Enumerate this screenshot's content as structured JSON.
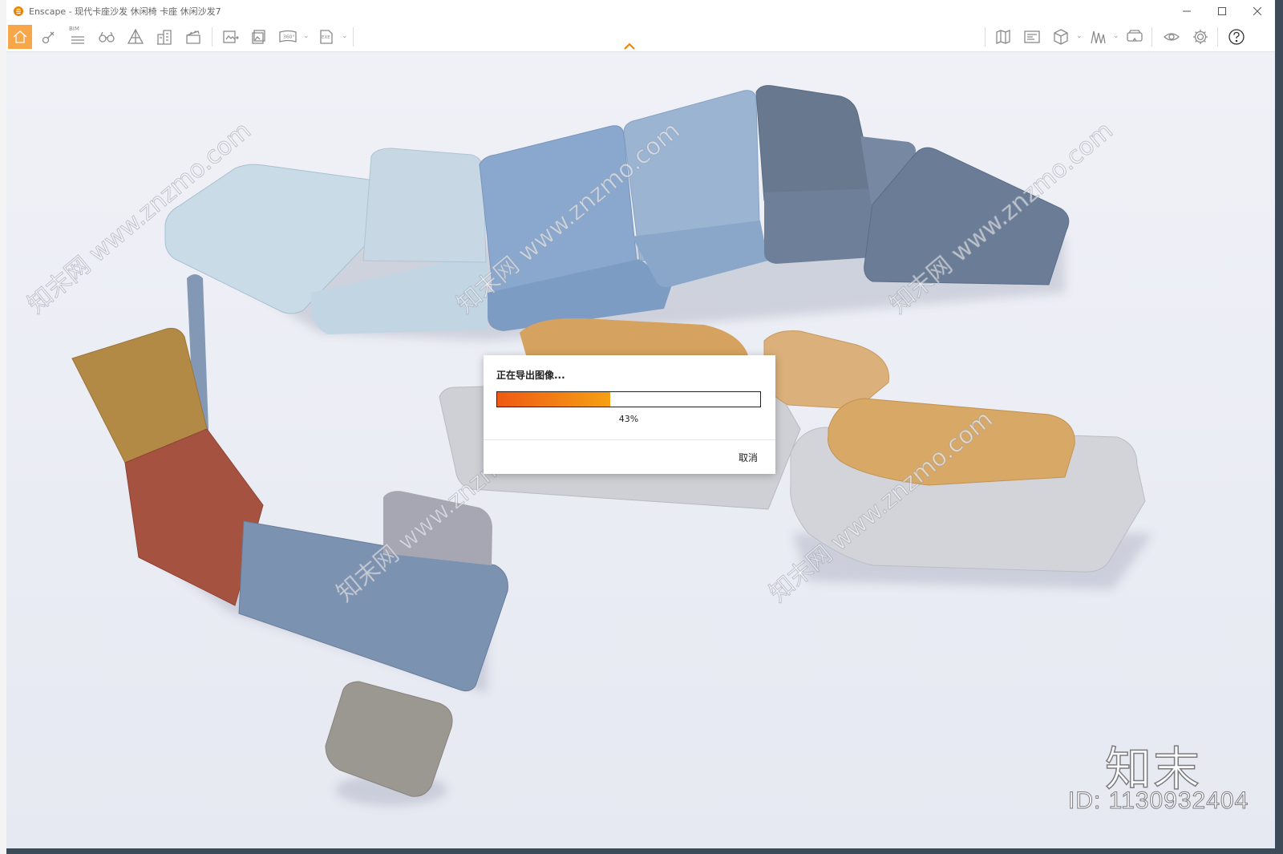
{
  "window": {
    "title": "Enscape - 现代卡座沙发 休闲椅 卡座 休闲沙发7"
  },
  "toolbar": {
    "bim_label": "BIM",
    "left_icons": [
      "home-icon",
      "paint-icon",
      "bim-list-icon",
      "binoculars-icon",
      "perspective-icon",
      "buildings-icon",
      "clapper-icon",
      "screenshot-icon",
      "batch-render-icon",
      "panorama-icon",
      "export-exe-icon"
    ],
    "right_icons": [
      "map-icon",
      "sketch-icon",
      "cube-icon",
      "visual-settings-icon",
      "vr-headset-icon",
      "eye-icon",
      "gear-icon",
      "help-icon"
    ],
    "panorama_label": "360°",
    "exe_label": "EXE"
  },
  "dialog": {
    "title": "正在导出图像...",
    "progress": 0.43,
    "progress_label": "43%",
    "cancel_label": "取消"
  },
  "watermark": {
    "logo": "知末",
    "id": "ID: 1130932404",
    "diagonal": "知末网 www.znzmo.com"
  },
  "colors": {
    "accent": "#f08000",
    "progress_start": "#ef5a14",
    "progress_end": "#f6a014",
    "home_button": "#f7a64a"
  }
}
